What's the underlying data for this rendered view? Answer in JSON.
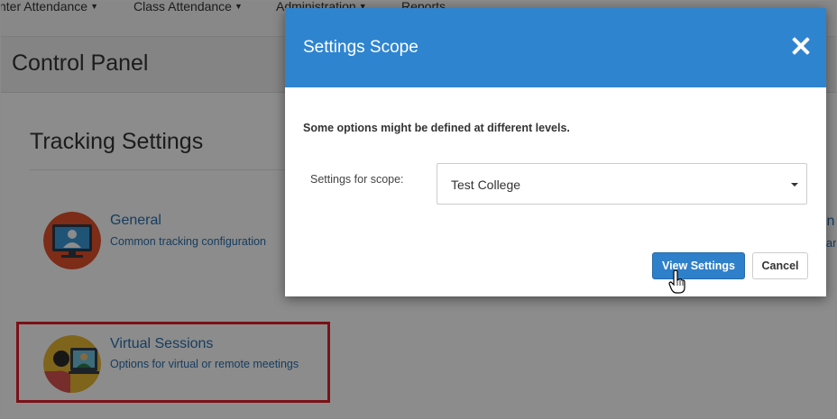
{
  "nav": {
    "items": [
      {
        "label": "nter Attendance"
      },
      {
        "label": "Class Attendance"
      },
      {
        "label": "Administration"
      },
      {
        "label": "Reports"
      }
    ]
  },
  "page": {
    "title": "Control Panel",
    "section_title": "Tracking Settings"
  },
  "cards": {
    "general": {
      "title": "General",
      "description": "Common tracking configuration",
      "icon": "monitor-user-icon"
    },
    "virtual": {
      "title": "Virtual Sessions",
      "description": "Options for virtual or remote meetings",
      "icon": "video-meeting-icon"
    }
  },
  "edge_fragments": {
    "top": "in",
    "bottom": "lar"
  },
  "modal": {
    "title": "Settings Scope",
    "message": "Some options might be defined at different levels.",
    "scope_label": "Settings for scope:",
    "scope_value": "Test College",
    "view_button": "View Settings",
    "cancel_button": "Cancel",
    "header_color": "#2f84d0"
  },
  "colors": {
    "accent": "#2f84d0",
    "link": "#2a6fb0",
    "highlight": "#e0202b"
  }
}
